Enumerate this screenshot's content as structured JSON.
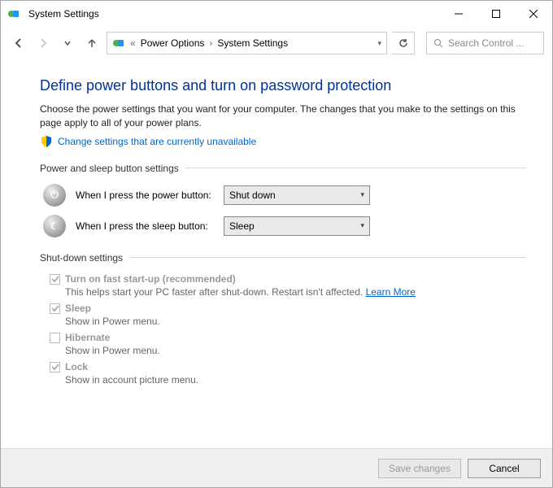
{
  "window": {
    "title": "System Settings"
  },
  "breadcrumb": {
    "sep": "«",
    "items": [
      "Power Options",
      "System Settings"
    ]
  },
  "search": {
    "placeholder": "Search Control ..."
  },
  "page": {
    "heading": "Define power buttons and turn on password protection",
    "description": "Choose the power settings that you want for your computer. The changes that you make to the settings on this page apply to all of your power plans.",
    "change_link": "Change settings that are currently unavailable"
  },
  "groups": {
    "buttons": {
      "title": "Power and sleep button settings",
      "rows": [
        {
          "icon": "⏻",
          "label": "When I press the power button:",
          "value": "Shut down"
        },
        {
          "icon": "☾",
          "label": "When I press the sleep button:",
          "value": "Sleep"
        }
      ]
    },
    "shutdown": {
      "title": "Shut-down settings",
      "items": [
        {
          "checked": true,
          "disabled": true,
          "title": "Turn on fast start-up (recommended)",
          "desc": "This helps start your PC faster after shut-down. Restart isn't affected.",
          "learn": "Learn More"
        },
        {
          "checked": true,
          "disabled": true,
          "title": "Sleep",
          "desc": "Show in Power menu."
        },
        {
          "checked": false,
          "disabled": true,
          "title": "Hibernate",
          "desc": "Show in Power menu."
        },
        {
          "checked": true,
          "disabled": true,
          "title": "Lock",
          "desc": "Show in account picture menu."
        }
      ]
    }
  },
  "footer": {
    "save": "Save changes",
    "cancel": "Cancel"
  }
}
